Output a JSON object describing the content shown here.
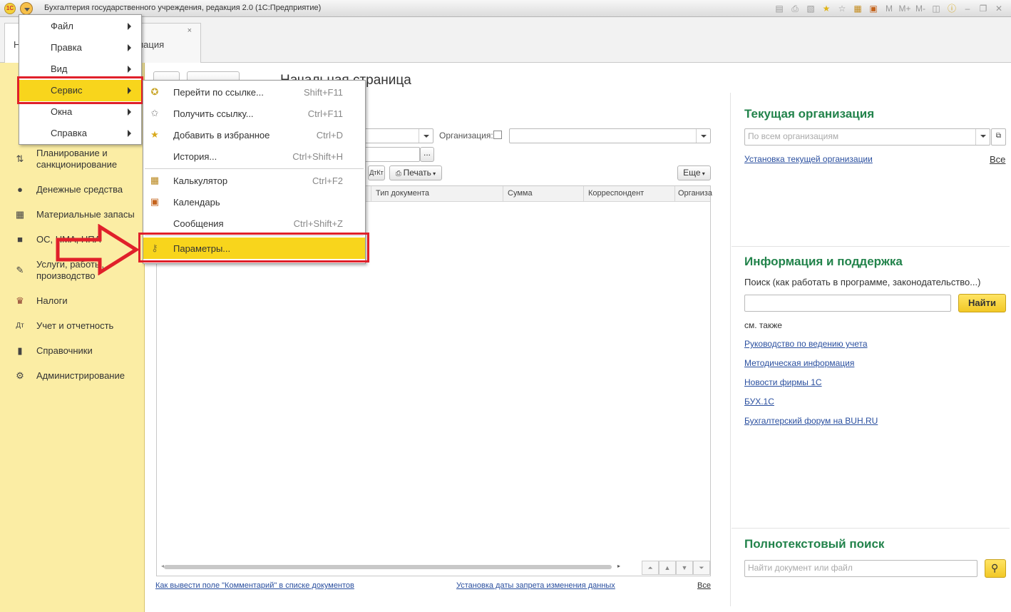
{
  "window": {
    "title": "Бухгалтерия государственного учреждения, редакция 2.0  (1С:Предприятие)",
    "logo_text": "1С"
  },
  "toolbar_icons": [
    "save-icon",
    "print-icon",
    "preview-icon",
    "favorites-star-icon",
    "favorites-list-icon",
    "calculator-icon",
    "calendar-icon",
    "memory-m-icon",
    "memory-mplus-icon",
    "memory-mminus-icon",
    "panels-icon",
    "info-icon",
    "minimize-icon",
    "restore-icon",
    "close-icon"
  ],
  "toolbar_labels": {
    "m": "M",
    "mplus": "M+",
    "mminus": "M-"
  },
  "tabs": [
    {
      "label": "Н"
    },
    {
      "label": "рмация",
      "close": "×"
    }
  ],
  "sidebar": {
    "items": [
      {
        "label": "Планирование и санкционирование",
        "icon": "planning-icon"
      },
      {
        "label": "Денежные средства",
        "icon": "money-icon"
      },
      {
        "label": "Материальные запасы",
        "icon": "stock-icon"
      },
      {
        "label": "ОС, НМА, НПА",
        "icon": "truck-icon"
      },
      {
        "label": "Услуги, работы, производство",
        "icon": "tools-icon"
      },
      {
        "label": "Налоги",
        "icon": "eagle-icon"
      },
      {
        "label": "Учет и отчетность",
        "icon": "accounting-icon"
      },
      {
        "label": "Справочники",
        "icon": "books-icon"
      },
      {
        "label": "Администрирование",
        "icon": "gear-icon"
      }
    ]
  },
  "main": {
    "page_title": "Начальная страница",
    "org_label": "Организация:",
    "print_button": "Печать",
    "more_button": "Еще",
    "ellipsis_button": "...",
    "columns": [
      "Тип документа",
      "Сумма",
      "Корреспондент",
      "Организа"
    ],
    "bottom_links": {
      "comment": "Как вывести поле \"Комментарий\" в списке документов",
      "lock_date": "Установка даты запрета изменения данных",
      "all": "Все"
    }
  },
  "right_panel": {
    "current_org": {
      "title": "Текущая организация",
      "placeholder": "По всем организациям",
      "link": "Установка текущей организации",
      "all": "Все"
    },
    "info_support": {
      "title": "Информация и поддержка",
      "search_label": "Поиск (как работать в программе, законодательство...)",
      "find_button": "Найти",
      "see_also": "см. также",
      "links": [
        "Руководство по ведению учета",
        "Методическая информация",
        "Новости фирмы 1С",
        "БУХ.1С",
        "Бухгалтерский форум на BUH.RU"
      ]
    },
    "fulltext": {
      "title": "Полнотекстовый поиск",
      "placeholder": "Найти документ или файл"
    }
  },
  "main_menu": {
    "items": [
      {
        "label": "Файл"
      },
      {
        "label": "Правка"
      },
      {
        "label": "Вид"
      },
      {
        "label": "Сервис",
        "selected": true
      },
      {
        "label": "Окна"
      },
      {
        "label": "Справка"
      }
    ]
  },
  "service_menu": {
    "items": [
      {
        "label": "Перейти по ссылке...",
        "shortcut": "Shift+F11",
        "icon": "go-link-icon"
      },
      {
        "label": "Получить ссылку...",
        "shortcut": "Ctrl+F11",
        "icon": "get-link-icon"
      },
      {
        "label": "Добавить в избранное",
        "shortcut": "Ctrl+D",
        "icon": "add-favorite-icon"
      },
      {
        "label": "История...",
        "shortcut": "Ctrl+Shift+H",
        "icon": ""
      },
      {
        "label": "Калькулятор",
        "shortcut": "Ctrl+F2",
        "icon": "calculator-icon"
      },
      {
        "label": "Календарь",
        "shortcut": "",
        "icon": "calendar-icon"
      },
      {
        "label": "Сообщения",
        "shortcut": "Ctrl+Shift+Z",
        "icon": ""
      },
      {
        "label": "Параметры...",
        "shortcut": "",
        "icon": "wrench-icon",
        "selected": true
      }
    ]
  },
  "colors": {
    "accent_yellow": "#f8d51c",
    "sidebar_bg": "#fbeda4",
    "highlight_red": "#e0202a",
    "section_green": "#22834b",
    "link_blue": "#2a4f9f"
  }
}
